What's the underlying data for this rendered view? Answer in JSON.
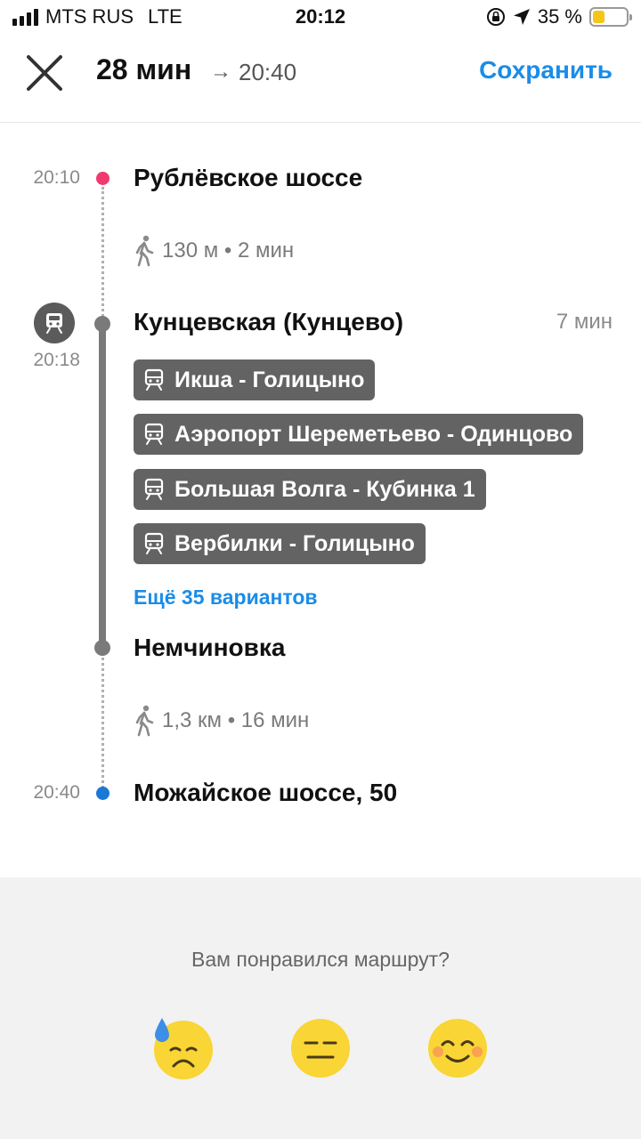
{
  "status_bar": {
    "carrier": "MTS RUS",
    "network": "LTE",
    "time": "20:12",
    "battery": "35 %",
    "battery_level": 0.35
  },
  "header": {
    "duration": "28 мин",
    "arrow": "→",
    "arrival": "20:40",
    "save_label": "Сохранить"
  },
  "route": {
    "start": {
      "time": "20:10",
      "name": "Рублёвское шоссе"
    },
    "walk1": {
      "label": "130 м • 2 мин"
    },
    "station": {
      "time": "20:18",
      "name": "Кунцевская (Кунцево)",
      "ride_time": "7 мин"
    },
    "trains": [
      {
        "label": "Икша - Голицыно"
      },
      {
        "label": "Аэропорт Шереметьево - Одинцово"
      },
      {
        "label": "Большая Волга - Кубинка 1"
      },
      {
        "label": "Вербилки - Голицыно"
      }
    ],
    "more": "Ещё 35 вариантов",
    "exit_station": {
      "name": "Немчиновка"
    },
    "walk2": {
      "label": "1,3 км • 16 мин"
    },
    "end": {
      "time": "20:40",
      "name": "Можайское шоссе, 50"
    }
  },
  "feedback": {
    "question": "Вам понравился маршрут?",
    "options": [
      "sad-face-icon",
      "neutral-face-icon",
      "smiling-face-icon"
    ]
  },
  "colors": {
    "accent": "#1a8ce8",
    "start_dot": "#f03a6e",
    "end_dot": "#1a78d6",
    "chip_bg": "#636363"
  }
}
